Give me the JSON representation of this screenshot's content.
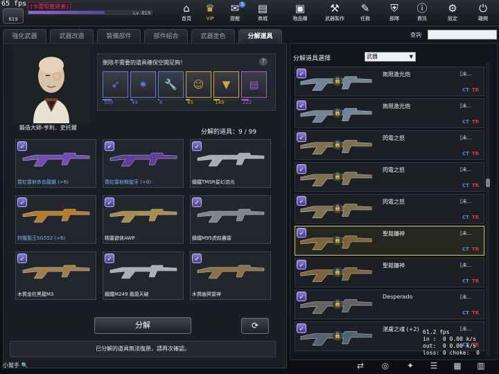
{
  "hud": {
    "fps_corner": "65 fps"
  },
  "player": {
    "name": "[卡蕾契撤退者]",
    "level": "Lv. 819",
    "rank_text": "819",
    "xp_fraction": 0.62
  },
  "nav": [
    {
      "id": "lobby",
      "label": "首頁",
      "icon": "⌂"
    },
    {
      "id": "vip",
      "label": "VIP",
      "icon": "♛"
    },
    {
      "id": "notice",
      "label": "提醒",
      "icon": "✉",
      "badge": "3"
    },
    {
      "id": "shop",
      "label": "商城",
      "icon": "▤"
    },
    {
      "id": "inventory",
      "label": "物品欄",
      "icon": "▣"
    },
    {
      "id": "craft",
      "label": "武器製作",
      "icon": "⚒"
    },
    {
      "id": "mission",
      "label": "任務",
      "icon": "✎"
    },
    {
      "id": "clan",
      "label": "部隊",
      "icon": "⛨"
    },
    {
      "id": "info",
      "label": "資訊",
      "icon": "ⓘ"
    },
    {
      "id": "settings",
      "label": "設定",
      "icon": "⚙"
    },
    {
      "id": "exit",
      "label": "離開",
      "icon": "⏻"
    }
  ],
  "tabs": [
    "強化武器",
    "武器改造",
    "裝備部件",
    "部件組合",
    "武器塗色",
    "分解道具"
  ],
  "active_tab": 5,
  "info_text": "刪除不需要的道具確保空間足夠！",
  "help_label": "?",
  "materials": [
    {
      "name": "bullet",
      "count": "509",
      "color": "#5a7fd6",
      "fill": 0.35
    },
    {
      "name": "circuit",
      "count": "44",
      "color": "#5a7fd6",
      "fill": 0.1
    },
    {
      "name": "wrench",
      "count": "8",
      "color": "#5a7fd6",
      "fill": 0.05
    },
    {
      "name": "crate",
      "count": "45",
      "color": "#d6a83a",
      "fill": 0.15
    },
    {
      "name": "vest",
      "count": "149",
      "color": "#d6a83a",
      "fill": 0.25
    },
    {
      "name": "book",
      "count": "222",
      "color": "#a55ad6",
      "fill": 0.3
    }
  ],
  "npc": {
    "name": "鍛造大師-亨利．史托爾"
  },
  "dismantle": {
    "label": "分解的道具",
    "count": "9 / 99"
  },
  "cards": [
    {
      "name": "霓虹雷射赤血龍鋸 (+6)",
      "blue": true,
      "color": "#7a4fc9"
    },
    {
      "name": "霓虹雷射鯨旋牙 (+6)",
      "blue": true,
      "color": "#6a3fb0"
    },
    {
      "name": "鑄鐵TMSR星幻流光",
      "blue": false,
      "color": "#b6bcc6"
    },
    {
      "name": "狩魔聖王SG552 (+6)",
      "blue": true,
      "color": "#c8862a"
    },
    {
      "name": "精靈遊俠AWP",
      "blue": false,
      "color": "#b69a4a"
    },
    {
      "name": "鑄鐵M95虎紋轟雷",
      "blue": false,
      "color": "#8c9096"
    },
    {
      "name": "木質金柱黑龍M3",
      "blue": false,
      "color": "#b08850"
    },
    {
      "name": "鑄鐵M249 鳳凰天破",
      "blue": false,
      "color": "#b8bec6"
    },
    {
      "name": "木質幽冥雷神",
      "blue": false,
      "color": "#9a7a4a"
    }
  ],
  "buttons": {
    "dismantle": "分解",
    "refresh": "⟳"
  },
  "warning": "已分解的道具無法復原，請再次確認。",
  "helper": "小幫手",
  "search_label": "查詢",
  "right": {
    "select_label": "分解道具選擇",
    "dropdown_value": "武器",
    "rows": [
      {
        "name": "無限激光炮",
        "tag": "[未...",
        "color": "#7a8fa8",
        "selected": false
      },
      {
        "name": "無限激光炮",
        "tag": "[未...",
        "color": "#7a8fa8",
        "selected": false
      },
      {
        "name": "閃電之怒",
        "tag": "[未...",
        "color": "#8a7a50",
        "selected": false
      },
      {
        "name": "閃電之怒",
        "tag": "[未...",
        "color": "#8a7a50",
        "selected": false
      },
      {
        "name": "閃電之怒",
        "tag": "[未...",
        "color": "#8a7a50",
        "selected": false
      },
      {
        "name": "聖裁鐮神",
        "tag": "[未...",
        "color": "#8a6a3a",
        "selected": true
      },
      {
        "name": "聖裁鐮神",
        "tag": "[未...",
        "color": "#8a6a3a",
        "selected": false
      },
      {
        "name": "Desperado",
        "tag": "[未...",
        "color": "#6a6a6a",
        "selected": false
      },
      {
        "name": "湛盧之魂 (+2)",
        "tag": "[未...",
        "color": "#5a6a7a",
        "selected": false
      }
    ],
    "ct": "CT",
    "tr": "TR"
  },
  "netstats": "61.2 fps\nin :  0 0.00 k/s\nout:  0 0.00 k/s\nloss: 0 choke:  0"
}
